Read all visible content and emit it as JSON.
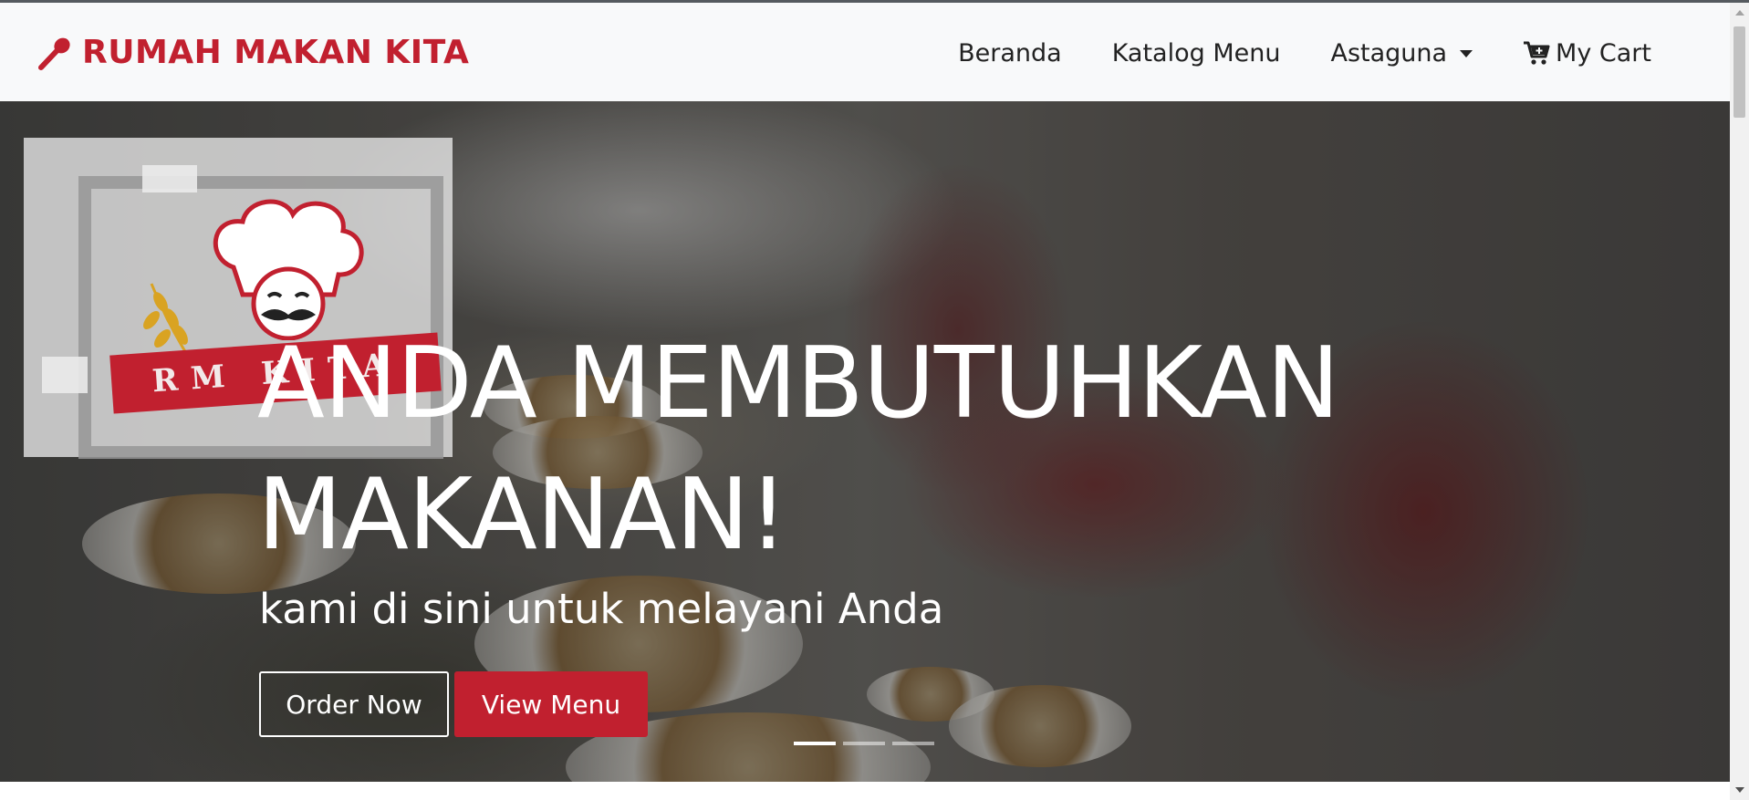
{
  "brand": {
    "name": "RUMAH MAKAN KITA",
    "icon": "spoon-icon",
    "color": "#c1202f"
  },
  "nav": {
    "items": [
      {
        "label": "Beranda"
      },
      {
        "label": "Katalog Menu"
      },
      {
        "label": "Astaguna",
        "has_dropdown": true
      }
    ],
    "cart": {
      "label": "My Cart",
      "icon": "cart-icon"
    }
  },
  "hero": {
    "logo_text": "RM KITA",
    "title": "ANDA MEMBUTUHKAN MAKANAN!",
    "subtitle": "kami di sini untuk melayani Anda",
    "buttons": {
      "order": "Order Now",
      "menu": "View Menu"
    },
    "slides_total": 3,
    "active_slide": 1,
    "accent_color": "#c1202f"
  }
}
